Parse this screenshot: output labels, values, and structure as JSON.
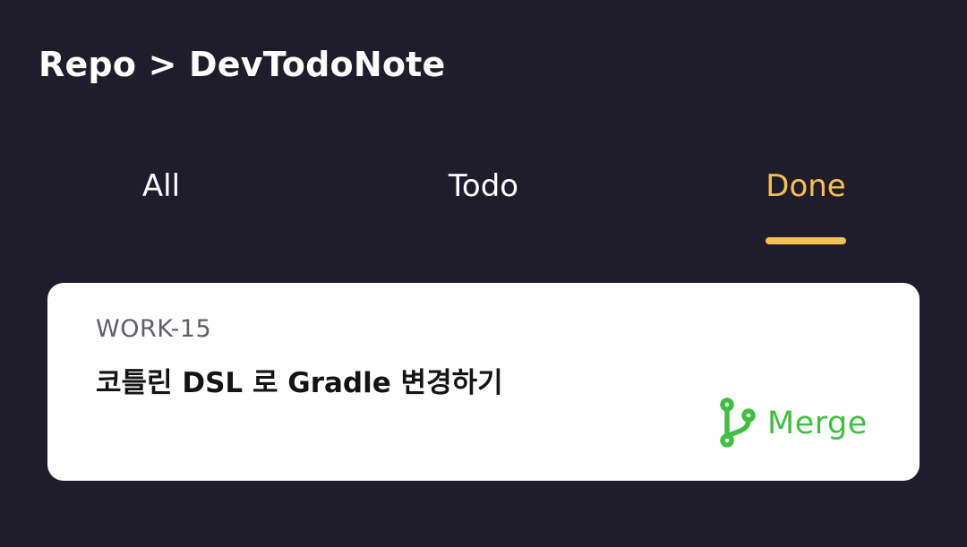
{
  "header": {
    "breadcrumb": "Repo > DevTodoNote"
  },
  "tabs": [
    {
      "label": "All",
      "active": false
    },
    {
      "label": "Todo",
      "active": false
    },
    {
      "label": "Done",
      "active": true
    }
  ],
  "colors": {
    "background": "#1f1d2c",
    "accent": "#f5c054",
    "card": "#ffffff",
    "merge": "#3fbf3f"
  },
  "issues": [
    {
      "id": "WORK-15",
      "title": "코틀린 DSL 로 Gradle 변경하기",
      "status_icon": "git-merge-icon",
      "status_label": "Merge"
    }
  ]
}
